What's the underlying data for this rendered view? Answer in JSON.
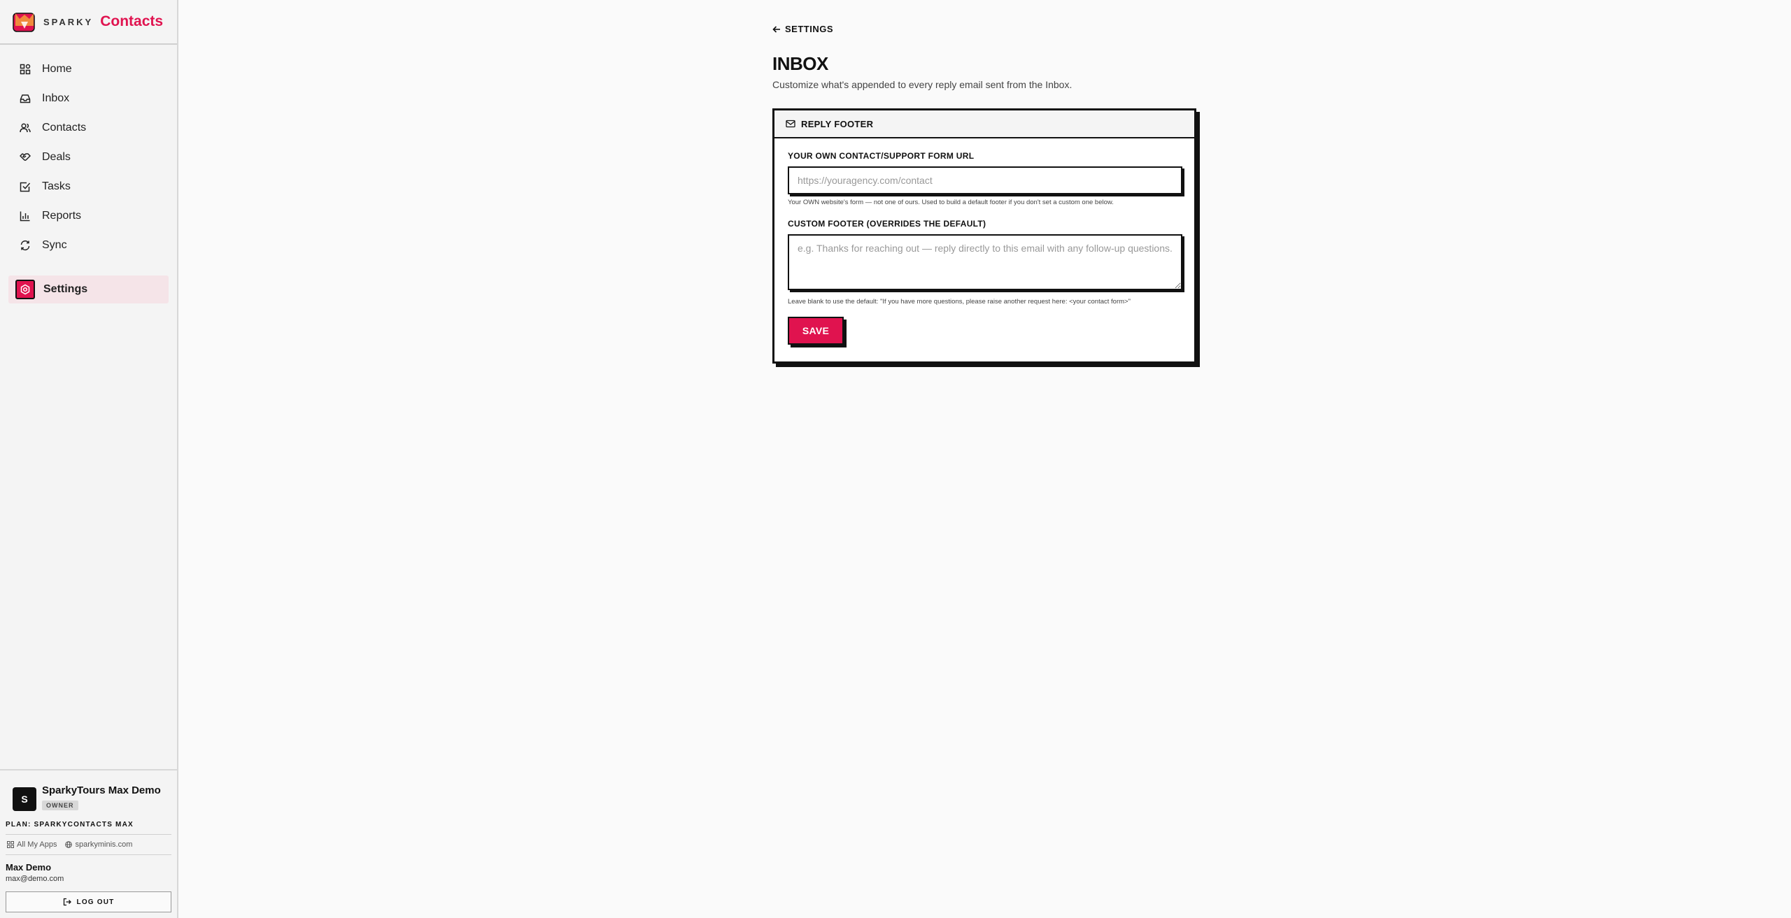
{
  "brand": {
    "small": "SPARKY",
    "big": "Contacts"
  },
  "nav": {
    "items": [
      {
        "label": "Home",
        "icon": "home-icon"
      },
      {
        "label": "Inbox",
        "icon": "inbox-icon"
      },
      {
        "label": "Contacts",
        "icon": "users-icon"
      },
      {
        "label": "Deals",
        "icon": "handshake-icon"
      },
      {
        "label": "Tasks",
        "icon": "checkbox-icon"
      },
      {
        "label": "Reports",
        "icon": "bar-chart-icon"
      },
      {
        "label": "Sync",
        "icon": "refresh-icon"
      }
    ],
    "active": {
      "label": "Settings",
      "icon": "settings-icon"
    }
  },
  "org": {
    "initial": "S",
    "name": "SparkyTours Max Demo",
    "role": "OWNER"
  },
  "plan": "PLAN: SPARKYCONTACTS MAX",
  "links": {
    "apps": "All My Apps",
    "site": "sparkyminis.com"
  },
  "user": {
    "name": "Max Demo",
    "email": "max@demo.com"
  },
  "logout_label": "LOG OUT",
  "main": {
    "back_label": "SETTINGS",
    "title": "INBOX",
    "subtitle": "Customize what's appended to every reply email sent from the Inbox.",
    "card": {
      "title": "REPLY FOOTER",
      "url_label": "YOUR OWN CONTACT/SUPPORT FORM URL",
      "url_placeholder": "https://youragency.com/contact",
      "url_value": "",
      "url_hint": "Your OWN website's form — not one of ours. Used to build a default footer if you don't set a custom one below.",
      "footer_label": "CUSTOM FOOTER (OVERRIDES THE DEFAULT)",
      "footer_placeholder": "e.g. Thanks for reaching out — reply directly to this email with any follow-up questions.",
      "footer_value": "",
      "footer_hint": "Leave blank to use the default: \"If you have more questions, please raise another request here: <your contact form>\"",
      "save_label": "SAVE"
    }
  },
  "colors": {
    "accent": "#e0134f",
    "ink": "#111111",
    "active_bg": "#f5e4e8"
  }
}
